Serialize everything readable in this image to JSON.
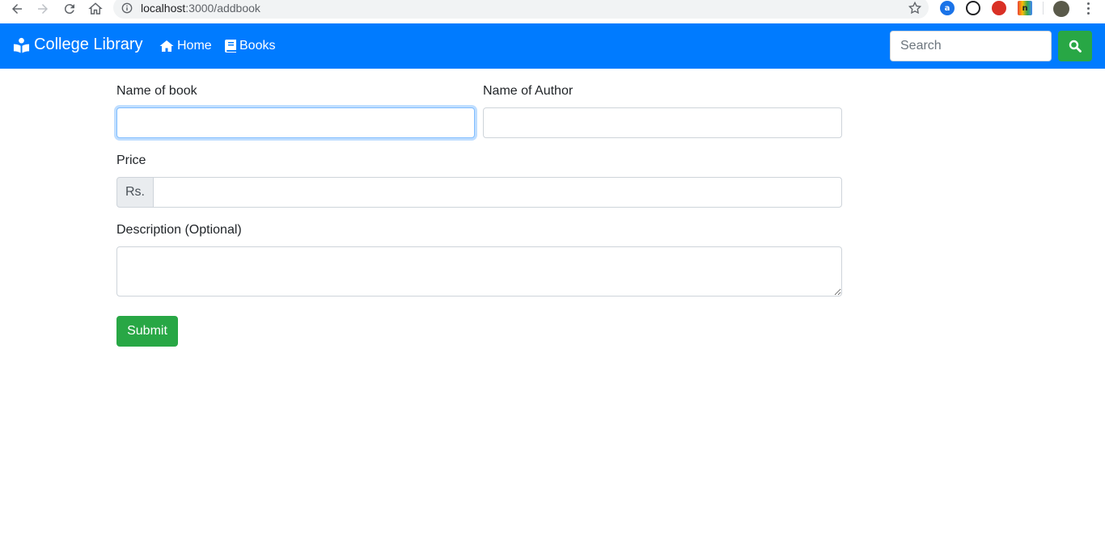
{
  "browser": {
    "url_host": "localhost",
    "url_path": ":3000/addbook",
    "extensions": [
      {
        "name": "extension-a-icon",
        "glyph": "a",
        "color": "#1a73e8"
      },
      {
        "name": "extension-loop-icon",
        "glyph": "",
        "color": "#202124"
      },
      {
        "name": "extension-hand-icon",
        "glyph": "",
        "color": "#d93025"
      },
      {
        "name": "extension-n-icon",
        "glyph": "n",
        "color": "#202124"
      }
    ]
  },
  "navbar": {
    "brand": "College Library",
    "links": [
      {
        "label": "Home",
        "icon": "home-icon"
      },
      {
        "label": "Books",
        "icon": "book-icon"
      }
    ],
    "search_placeholder": "Search",
    "colors": {
      "primary": "#007bff",
      "success": "#28a745"
    }
  },
  "form": {
    "book_name_label": "Name of book",
    "author_label": "Name of Author",
    "price_label": "Price",
    "price_prefix": "Rs.",
    "description_label": "Description (Optional)",
    "submit_label": "Submit"
  }
}
